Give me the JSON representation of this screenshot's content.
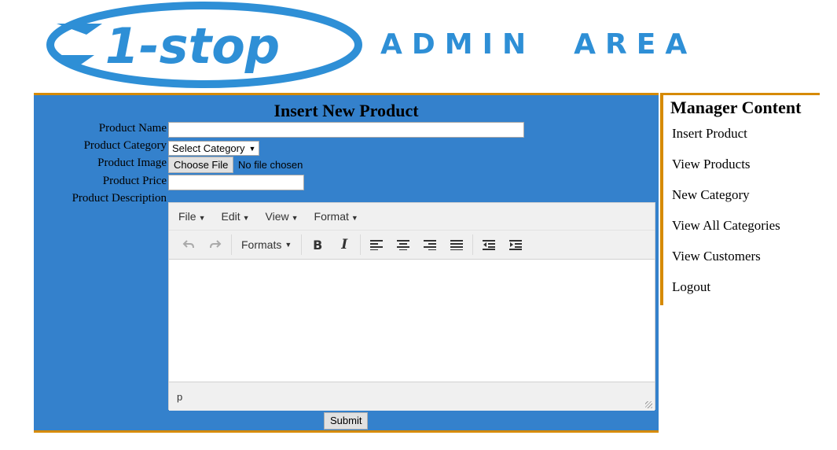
{
  "header": {
    "logo_text": "1-stop",
    "subtitle": "ADMIN  AREA"
  },
  "form": {
    "title": "Insert New Product",
    "product_name": {
      "label": "Product Name",
      "value": ""
    },
    "product_category": {
      "label": "Product Category",
      "selected": "Select Category"
    },
    "product_image": {
      "label": "Product Image",
      "button": "Choose File",
      "status": "No file chosen"
    },
    "product_price": {
      "label": "Product Price",
      "value": ""
    },
    "product_description": {
      "label": "Product Description"
    },
    "submit_label": "Submit"
  },
  "editor": {
    "menus": [
      "File",
      "Edit",
      "View",
      "Format"
    ],
    "formats_label": "Formats",
    "status_path": "p"
  },
  "sidebar": {
    "title": "Manager Content",
    "links": [
      "Insert Product",
      "View Products",
      "New Category",
      "View All Categories",
      "View Customers",
      "Logout"
    ]
  },
  "colors": {
    "main_bg": "#3481cc",
    "accent_border": "#d68a00",
    "logo_blue": "#2e8fd6"
  }
}
